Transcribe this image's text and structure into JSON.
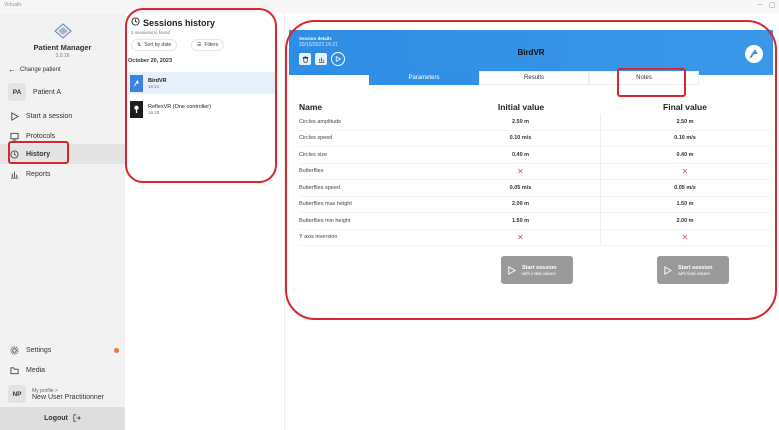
{
  "window": {
    "app_name": "Virtualis",
    "minimize_symbol": "–",
    "restore_symbol": "▢"
  },
  "sidebar": {
    "app_name": "Patient Manager",
    "version": "3.0.16",
    "change_patient": "Change patient",
    "patient_initials": "PA",
    "patient_name": "Patient A",
    "nav": {
      "start_session": "Start a session",
      "protocols": "Protocols",
      "history": "History",
      "reports": "Reports",
      "settings": "Settings",
      "media": "Media"
    },
    "profile": {
      "initials": "NP",
      "label": "My profile >",
      "name": "New User Practitionner"
    },
    "logout": "Logout"
  },
  "history": {
    "title": "Sessions history",
    "count": "2 sessions(s) found",
    "sort_label": "Sort by date",
    "filters_label": "Filters",
    "date_header": "October 20, 2023",
    "sessions": [
      {
        "name": "BirdVR",
        "time": "16:21"
      },
      {
        "name": "ReflexVR (One controller)",
        "time": "16:20"
      }
    ]
  },
  "detail": {
    "details_label": "Session details",
    "date": "20/10/2023 16:21",
    "title": "BirdVR",
    "tabs": [
      "Parameters",
      "Results",
      "Notes"
    ],
    "table": {
      "headers": [
        "Name",
        "Initial value",
        "Final value"
      ],
      "rows": [
        {
          "name": "Circles amplitude",
          "initial": "2.50 m",
          "final": "2.50 m"
        },
        {
          "name": "Circles speed",
          "initial": "0.10 m/s",
          "final": "0.10 m/s"
        },
        {
          "name": "Circles size",
          "initial": "0.40 m",
          "final": "0.40 m"
        },
        {
          "name": "Butterflies",
          "initial": "✕",
          "final": "✕"
        },
        {
          "name": "Butterflies speed",
          "initial": "0.05 m/s",
          "final": "0.05 m/s"
        },
        {
          "name": "Butterflies max height",
          "initial": "2.00 m",
          "final": "1.50 m"
        },
        {
          "name": "Butterflies min height",
          "initial": "1.50 m",
          "final": "2.00 m"
        },
        {
          "name": "Y axis inversion",
          "initial": "✕",
          "final": "✕"
        }
      ]
    },
    "start_initial": {
      "line1": "Start session",
      "line2": "with initial values"
    },
    "start_final": {
      "line1": "Start session",
      "line2": "with final values"
    }
  },
  "colors": {
    "accent": "#2f90e6",
    "annotation": "#d7262e",
    "settings_dot": "#e8793a"
  }
}
